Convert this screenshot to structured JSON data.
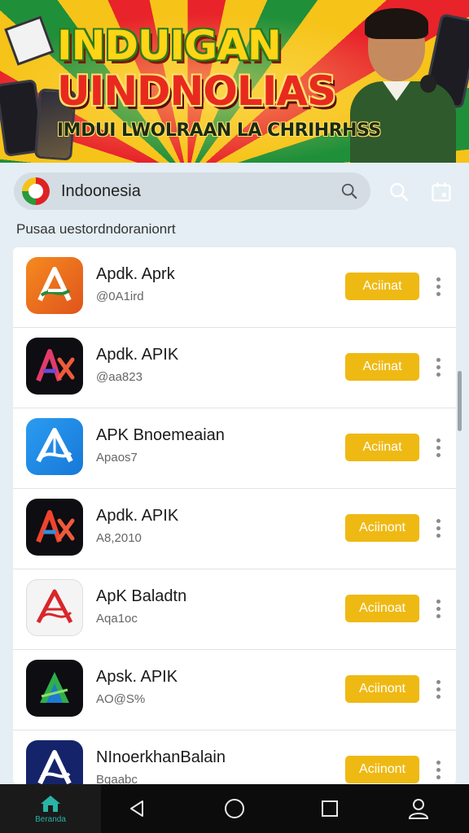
{
  "banner": {
    "title_line1": "INDUIGAN",
    "title_line2": "UINDNOLIAS",
    "subtitle": "IMDUI LWOLRAAN LA CHRIHRHSS"
  },
  "search": {
    "value": "Indoonesia",
    "icon": "search-icon"
  },
  "section_label": "Pusaa uestordndoranionrt",
  "apps": [
    {
      "name": "Apdk. Aprk",
      "meta": "@0A1ird",
      "button": "Aciinat",
      "icon_style": "orange-feather"
    },
    {
      "name": "Apdk. APIK",
      "meta": "@aa823",
      "button": "Aciinat",
      "icon_style": "dark-ax"
    },
    {
      "name": "APK Bnoemeaian",
      "meta": "Apaos7",
      "button": "Aciinat",
      "icon_style": "blue-a"
    },
    {
      "name": "Apdk. APIK",
      "meta": "A8,2010",
      "button": "Aciinont",
      "icon_style": "dark-ax-red"
    },
    {
      "name": "ApK Baladtn",
      "meta": "Aqa1oc",
      "button": "Aciinoat",
      "icon_style": "white-red-a"
    },
    {
      "name": "Apsk. APIK",
      "meta": "AO@S%",
      "button": "Aciinont",
      "icon_style": "green-a"
    },
    {
      "name": "NInoerkhanBalain",
      "meta": "Bgaabc",
      "button": "Aciinont",
      "icon_style": "navy-a"
    }
  ],
  "navbar": {
    "home_label": "Beranda"
  },
  "colors": {
    "accent": "#efb914",
    "page_bg": "#e4eef4",
    "nav_bg": "#0c0c0c",
    "nav_active": "#2ab3a6"
  }
}
